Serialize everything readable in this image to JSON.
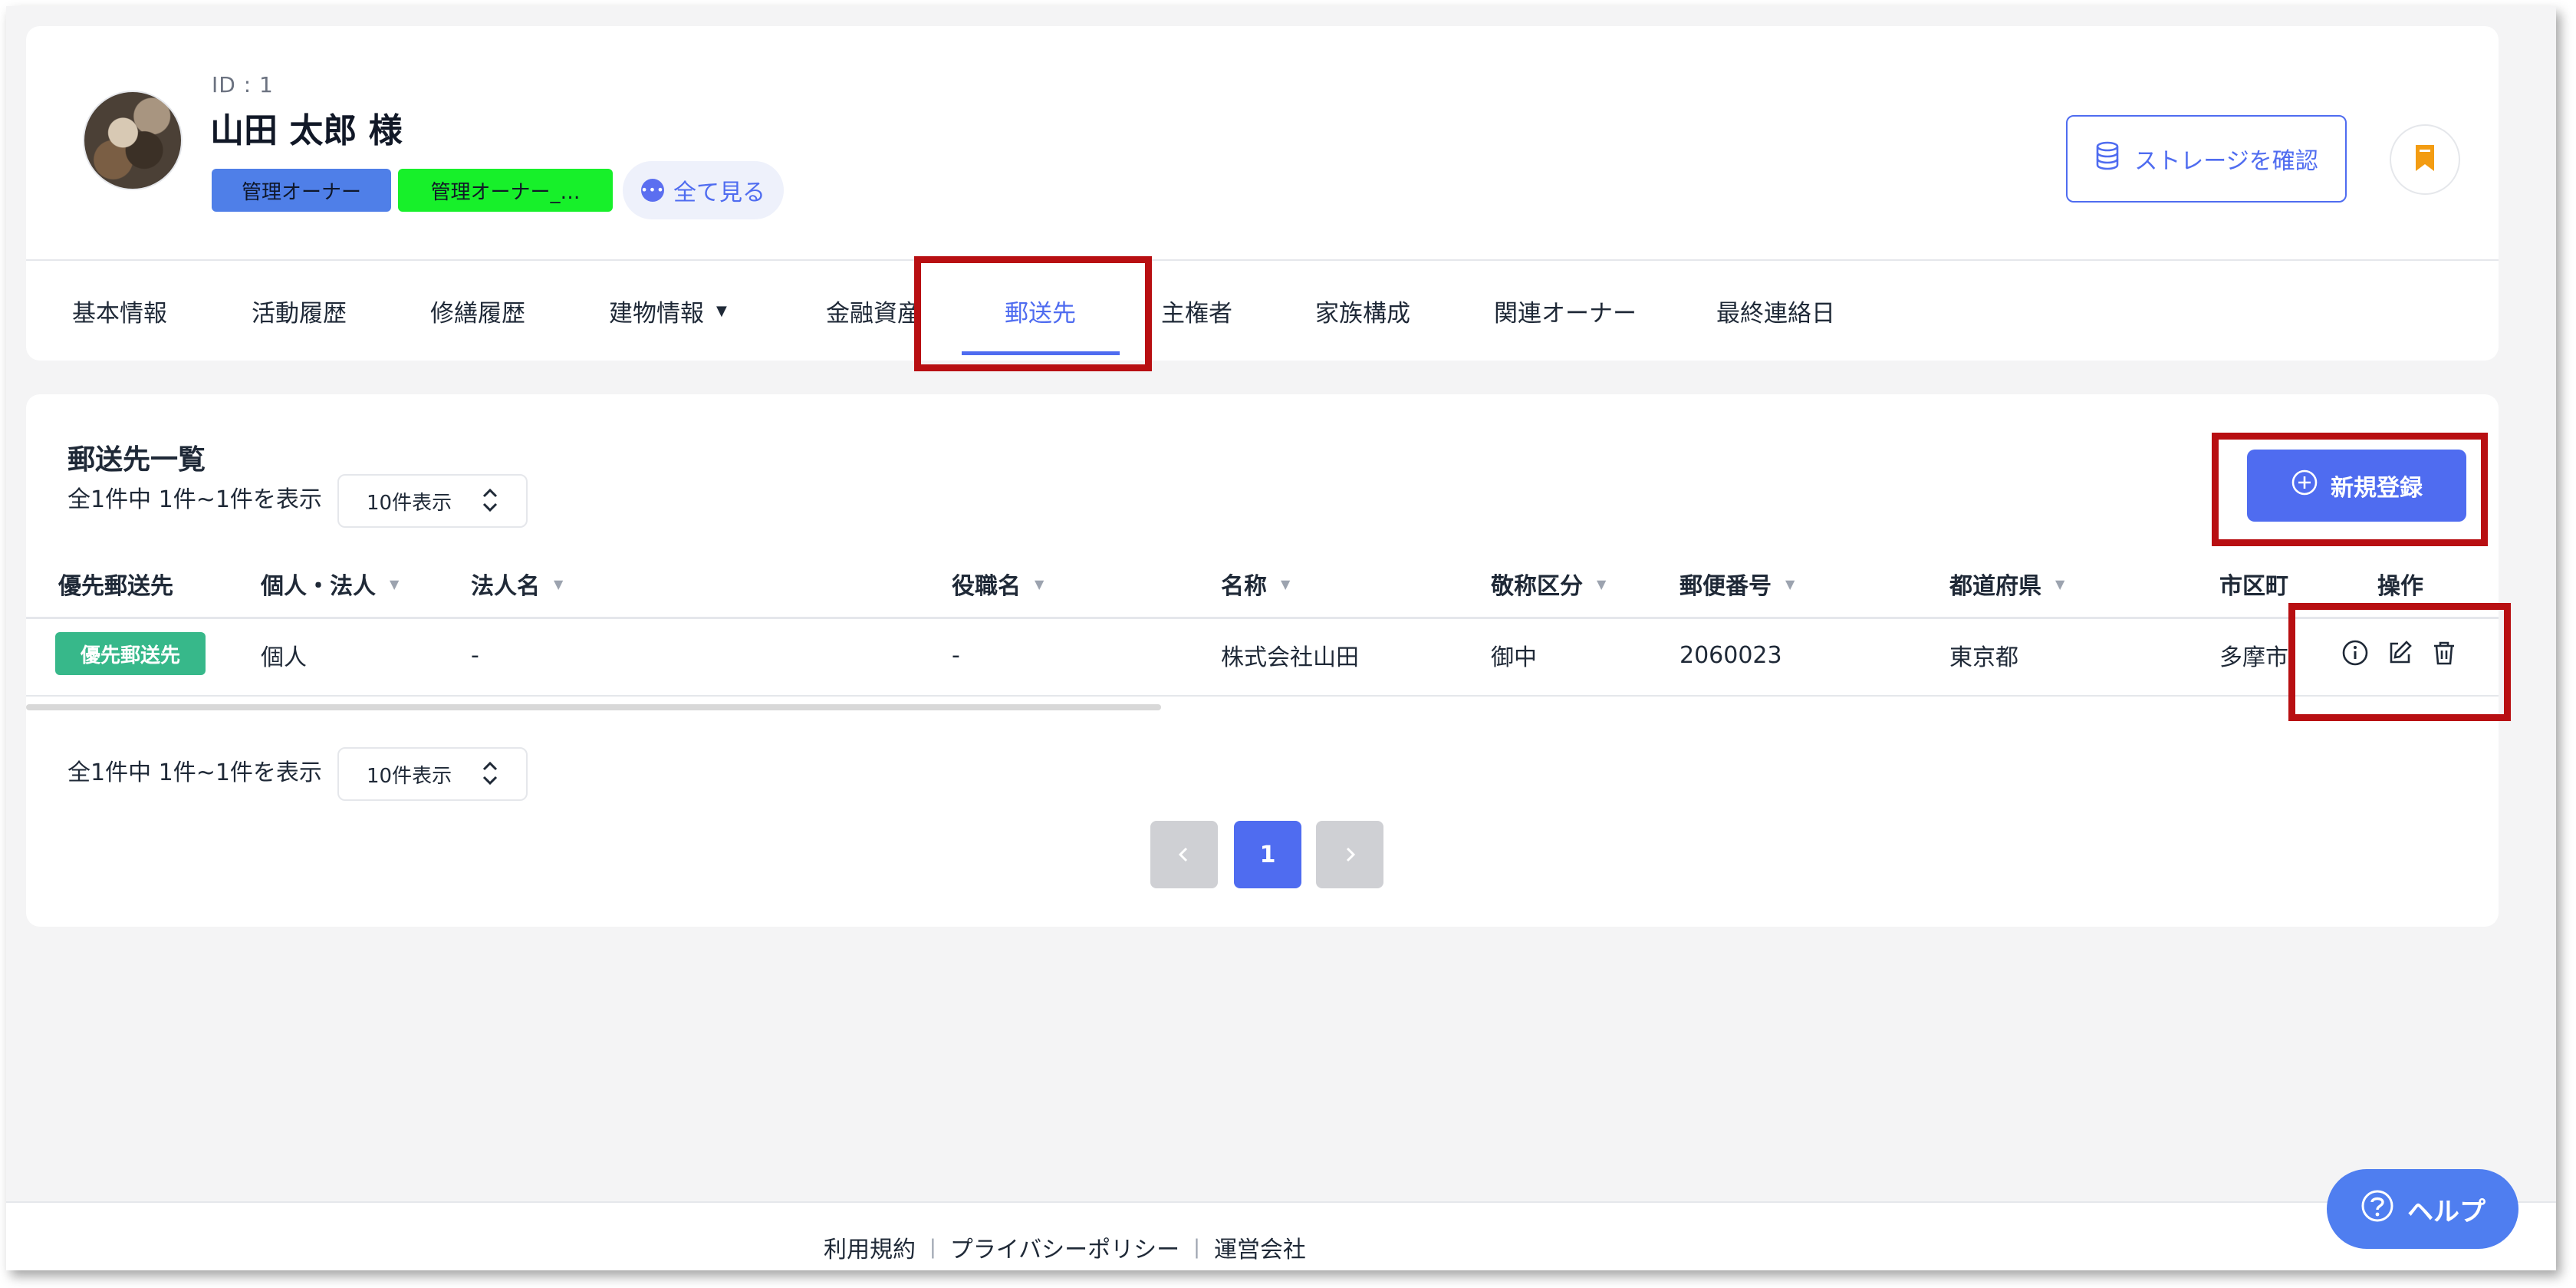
{
  "owner": {
    "id_label": "ID : 1",
    "name": "山田 太郎 様",
    "tags": [
      "管理オーナー",
      "管理オーナー_…"
    ],
    "see_all_label": "全て見る"
  },
  "header_actions": {
    "storage_label": "ストレージを確認",
    "bookmark_icon": "bookmark-icon"
  },
  "tabs": [
    {
      "label": "基本情報"
    },
    {
      "label": "活動履歴"
    },
    {
      "label": "修繕履歴"
    },
    {
      "label": "建物情報"
    },
    {
      "label": "金融資産"
    },
    {
      "label": "郵送先",
      "active": true
    },
    {
      "label": "主権者"
    },
    {
      "label": "家族構成"
    },
    {
      "label": "関連オーナー"
    },
    {
      "label": "最終連絡日"
    }
  ],
  "list": {
    "title": "郵送先一覧",
    "summary": "全1件中 1件~1件を表示",
    "per_page": "10件表示",
    "new_button": "新規登録",
    "columns": [
      "優先郵送先",
      "個人・法人",
      "法人名",
      "役職名",
      "名称",
      "敬称区分",
      "郵便番号",
      "都道府県",
      "市区町村",
      "操作"
    ],
    "rows": [
      {
        "priority": "優先郵送先",
        "type": "個人",
        "corp_name": "-",
        "position": "-",
        "name": "株式会社山田",
        "honorific": "御中",
        "postal_code": "2060023",
        "prefecture": "東京都",
        "city": "多摩市"
      }
    ],
    "pagination": {
      "current": "1"
    }
  },
  "footer": {
    "terms": "利用規約",
    "privacy": "プライバシーポリシー",
    "company": "運営会社",
    "separator": "|"
  },
  "help_label": "ヘルプ",
  "colors": {
    "accent": "#4f6cf0",
    "priority_badge": "#37b88a",
    "highlight": "#b80f12",
    "tag_green": "#17f02a"
  }
}
